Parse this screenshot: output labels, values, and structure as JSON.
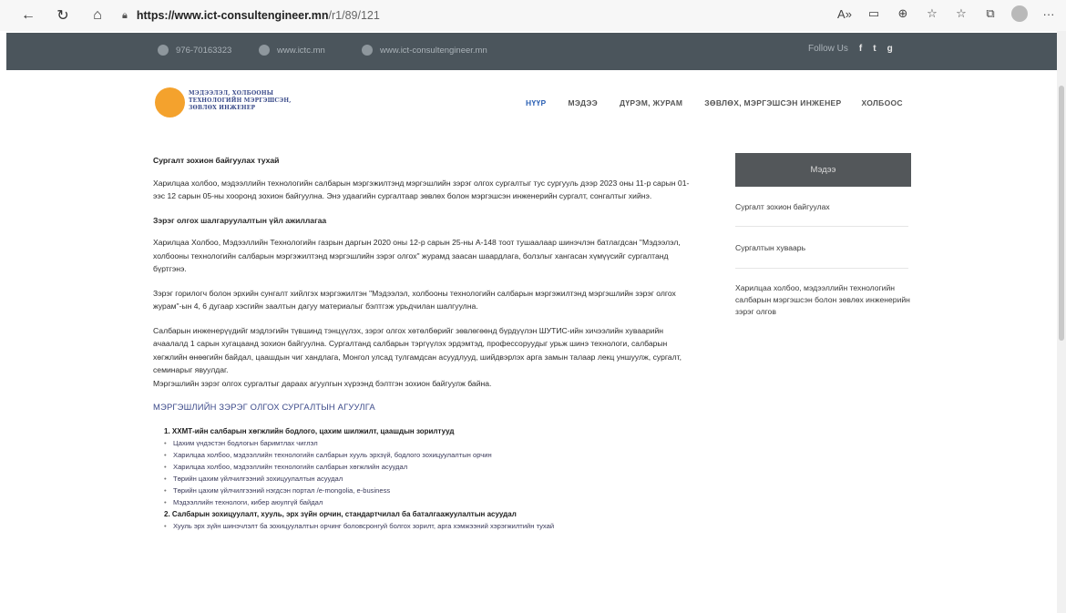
{
  "browser": {
    "url_host": "https://www.ict-consultengineer.mn",
    "url_path": "/r1/89/121"
  },
  "topbar": {
    "phone": "976-70163323",
    "site1": "www.ictc.mn",
    "site2": "www.ict-consultengineer.mn",
    "follow_label": "Follow Us",
    "social": [
      "f",
      "t",
      "g"
    ]
  },
  "header": {
    "logo_text": "МЭДЭЭЛЭЛ, ХОЛБООНЫ ТЕХНОЛОГИЙН МЭРГЭШСЭН, ЗӨВЛӨХ ИНЖЕНЕР",
    "nav": [
      "НҮҮР",
      "МЭДЭЭ",
      "ДҮРЭМ, ЖУРАМ",
      "ЗӨВЛӨХ, МЭРГЭШСЭН ИНЖЕНЕР",
      "ХОЛБООС"
    ]
  },
  "article": {
    "title": "Сургалт зохион байгуулах тухай",
    "p1": "Харилцаа холбоо, мэдээллийн технологийн салбарын мэргэжилтэнд мэргэшлийн зэрэг олгох сургалтыг тус сургууль дээр 2023 оны 11-р сарын 01-ээс 12 сарын 05-ны хооронд зохион байгуулна. Энэ удаагийн сургалтаар зөвлөх болон мэргэшсэн инженерийн сургалт, сонгалтыг хийнэ.",
    "subhead": "Зэрэг олгох шалгаруулалтын үйл ажиллагаа",
    "p2": "Харилцаа Холбоо, Мэдээллийн Технологийн газрын даргын 2020 оны 12-р сарын 25-ны А-148 тоот тушаалаар шинэчлэн батлагдсан \"Мэдээлэл, холбооны технологийн салбарын мэргэжилтэнд мэргэшлийн зэрэг олгох\" журамд заасан шаардлага, болзлыг хангасан хүмүүсийг сургалтанд бүртгэнэ.",
    "p3": "Зэрэг горилогч болон эрхийн сунгалт хийлгэх мэргэжилтэн \"Мэдээлэл, холбооны технологийн салбарын мэргэжилтэнд мэргэшлийн зэрэг олгох журам\"-ын 4, 6 дугаар хэсгийн заалтын дагуу материалыг бэлтгэж урьдчилан шалгуулна.",
    "p4": "Салбарын инженерүүдийг мэдлэгийн түвшинд тэнцүүлэх, зэрэг олгох хөтөлбөрийг зөвлөгөөнд бүрдүүлэн ШУТИС-ийн хичээлийн хуваарийн ачаалалд 1 сарын хугацаанд зохион байгуулна. Сургалтанд салбарын тэргүүлэх эрдэмтэд, профессоруудыг урьж шинэ технологи, салбарын хөгжлийн өнөөгийн байдал, цаашдын чиг хандлага, Монгол улсад тулгамдсан асуудлууд, шийдвэрлэх арга замын талаар лекц уншуулж, сургалт, семинарыг явуулдаг.",
    "p5": "Мэргэшлийн зэрэг олгох сургалтыг дараах агуулгын хүрээнд бэлтгэн зохион байгуулж байна.",
    "section_title": "МЭРГЭШЛИЙН ЗЭРЭГ ОЛГОХ СУРГАЛТЫН АГУУЛГА",
    "list": [
      {
        "type": "num",
        "text": "1. ХХМТ-ийн салбарын хөгжлийн бодлого, цахим шилжилт, цаашдын зорилтууд"
      },
      {
        "type": "bul",
        "text": "Цахим үндэстэн бодлогын баримтлах чиглэл"
      },
      {
        "type": "bul",
        "text": "Харилцаа холбоо, мэдээллийн технологийн салбарын хууль эрхзүй, бодлого зохицуулалтын орчин"
      },
      {
        "type": "bul",
        "text": "Харилцаа холбоо, мэдээллийн технологийн салбарын хөгжлийн асуудал"
      },
      {
        "type": "bul",
        "text": "Төрийн цахим үйлчилгээний зохицуулалтын асуудал"
      },
      {
        "type": "bul",
        "text": "Төрийн цахим үйлчилгээний нэгдсэн портал /e-mongolia, e-business"
      },
      {
        "type": "bul",
        "text": "Мэдээллийн технологи, кибер аюулгүй байдал"
      },
      {
        "type": "num",
        "text": "2. Салбарын зохицуулалт, хууль, эрх зүйн орчин, стандартчилал ба баталгаажуулалтын асуудал"
      },
      {
        "type": "bul",
        "text": "Хууль эрх зүйн шинэчлэлт ба зохицуулалтын орчинг боловсронгуй болгох зорилт, арга хэмжээний хэрэгжилтийн тухай"
      }
    ]
  },
  "sidebar": {
    "heading": "Мэдээ",
    "items": [
      "Сургалт зохион байгуулах",
      "Сургалтын хуваарь",
      "Харилцаа холбоо, мэдээллийн технологийн салбарын мэргэшсэн болон зөвлөх инженерийн зэрэг олгов"
    ]
  }
}
